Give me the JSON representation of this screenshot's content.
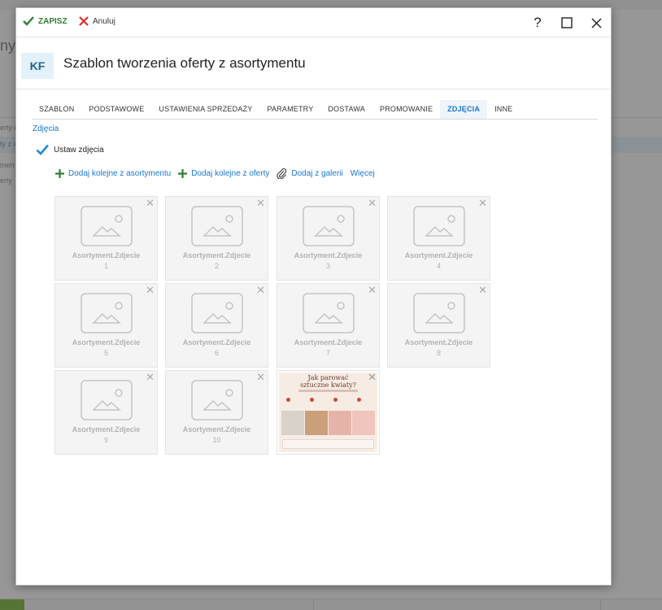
{
  "background": {
    "title_fragment": "ny",
    "sidebar_fragments": [
      "erty i",
      "ty z a",
      "men",
      "erty"
    ]
  },
  "toolbar": {
    "save_label": "ZAPISZ",
    "cancel_label": "Anuluj",
    "help_label": "?"
  },
  "header": {
    "badge": "KF",
    "title": "Szablon tworzenia oferty z asortymentu"
  },
  "tabs": [
    {
      "label": "SZABLON",
      "active": false
    },
    {
      "label": "PODSTAWOWE",
      "active": false
    },
    {
      "label": "USTAWIENIA SPRZEDAŻY",
      "active": false
    },
    {
      "label": "PARAMETRY",
      "active": false
    },
    {
      "label": "DOSTAWA",
      "active": false
    },
    {
      "label": "PROMOWANIE",
      "active": false
    },
    {
      "label": "ZDJĘCIA",
      "active": true
    },
    {
      "label": "INNE",
      "active": false
    }
  ],
  "section": {
    "link": "Zdjęcia",
    "checkbox_label": "Ustaw zdjęcia",
    "checkbox_checked": true
  },
  "actions": {
    "add_from_assortment": "Dodaj kolejne z asortymentu",
    "add_from_offer": "Dodaj kolejne z oferty",
    "add_from_gallery": "Dodaj z galerii",
    "more": "Więcej"
  },
  "photos": [
    {
      "label": "Asortyment.Zdjecie",
      "index": "1"
    },
    {
      "label": "Asortyment.Zdjecie",
      "index": "2"
    },
    {
      "label": "Asortyment.Zdjecie",
      "index": "3"
    },
    {
      "label": "Asortyment.Zdjecie",
      "index": "4"
    },
    {
      "label": "Asortyment.Zdjecie",
      "index": "5"
    },
    {
      "label": "Asortyment.Zdjecie",
      "index": "6"
    },
    {
      "label": "Asortyment.Zdjecie",
      "index": "7"
    },
    {
      "label": "Asortyment.Zdjecie",
      "index": "8"
    },
    {
      "label": "Asortyment.Zdjecie",
      "index": "9"
    },
    {
      "label": "Asortyment.Zdjecie",
      "index": "10"
    }
  ],
  "uploaded_photo": {
    "title_line1": "Jak parować",
    "title_line2": "sztuczne kwiaty?"
  },
  "colors": {
    "accent": "#1976d2",
    "save_green": "#2e7d32",
    "cancel_red": "#d32f2f",
    "badge_bg": "#e3f1fa"
  }
}
